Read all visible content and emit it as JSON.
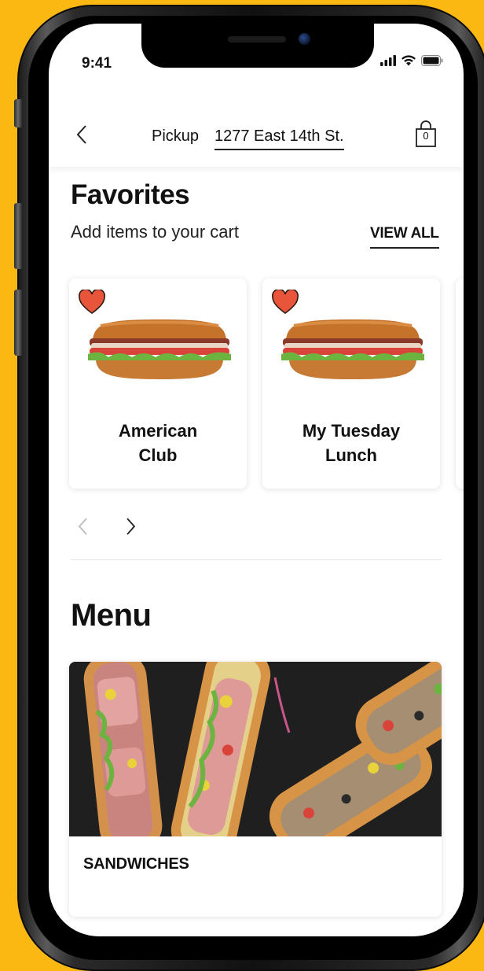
{
  "status_bar": {
    "time": "9:41",
    "icons": [
      "signal-icon",
      "wifi-icon",
      "battery-icon"
    ]
  },
  "header": {
    "back_icon": "chevron-left-icon",
    "pickup_label": "Pickup",
    "address": "1277 East 14th St.",
    "cart_icon": "shopping-bag-icon",
    "cart_count": "0"
  },
  "favorites": {
    "title": "Favorites",
    "subtitle": "Add items to your cart",
    "view_all": "VIEW ALL",
    "items": [
      {
        "name_line1": "American",
        "name_line2": "Club",
        "favorited": true
      },
      {
        "name_line1": "My Tuesday",
        "name_line2": "Lunch",
        "favorited": true
      }
    ],
    "carousel_prev_icon": "chevron-left-icon",
    "carousel_next_icon": "chevron-right-icon"
  },
  "menu": {
    "title": "Menu",
    "categories": [
      {
        "label": "SANDWICHES"
      }
    ]
  },
  "colors": {
    "background": "#FBB812",
    "heart": "#E8553B",
    "text": "#111111"
  }
}
